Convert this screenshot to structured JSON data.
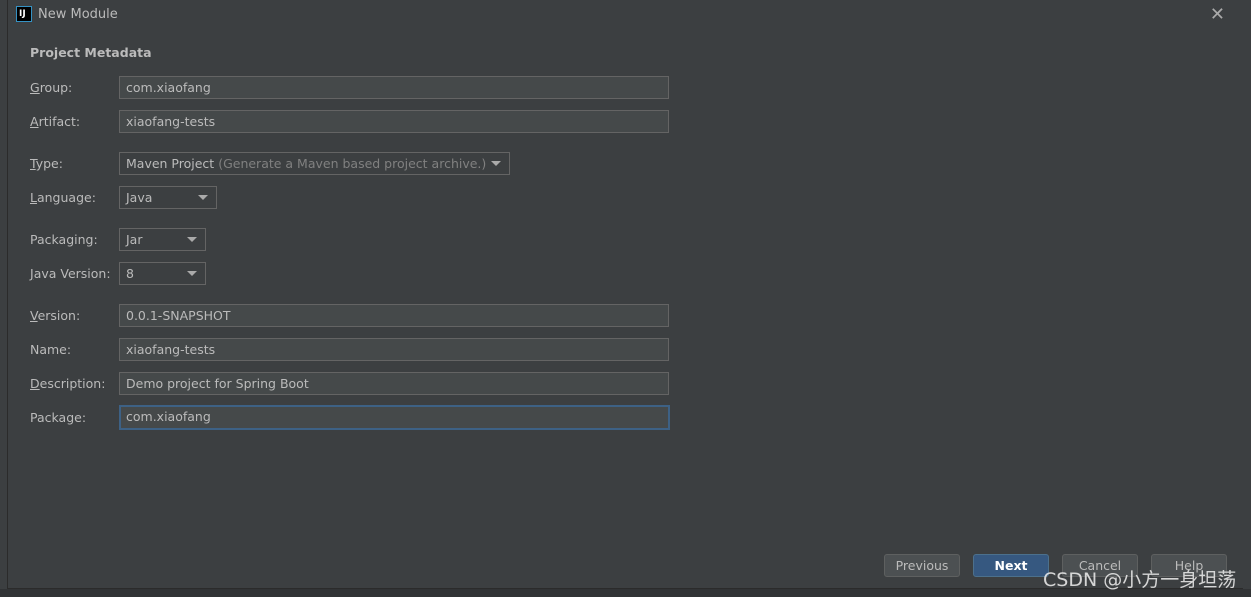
{
  "window": {
    "title": "New Module",
    "app_icon": "IJ"
  },
  "section_title": "Project Metadata",
  "fields": {
    "group": {
      "label": "Group:",
      "mn": "G",
      "rest": "roup:",
      "value": "com.xiaofang"
    },
    "artifact": {
      "label": "Artifact:",
      "mn": "A",
      "rest": "rtifact:",
      "value": "xiaofang-tests"
    },
    "type": {
      "label": "Type:",
      "mn": "T",
      "rest": "ype:",
      "value": "Maven Project",
      "hint": "(Generate a Maven based project archive.)"
    },
    "language": {
      "label": "Language:",
      "mn": "L",
      "rest": "anguage:",
      "value": "Java"
    },
    "packaging": {
      "label": "Packaging:",
      "value": "Jar"
    },
    "java_version": {
      "label": "Java Version:",
      "mn": "J",
      "rest": "ava Version:",
      "value": "8"
    },
    "version": {
      "label": "Version:",
      "mn": "V",
      "rest": "ersion:",
      "value": "0.0.1-SNAPSHOT"
    },
    "name": {
      "label": "Name:",
      "value": "xiaofang-tests"
    },
    "description": {
      "label": "Description:",
      "mn": "D",
      "rest": "escription:",
      "value": "Demo project for Spring Boot"
    },
    "package": {
      "label": "Package:",
      "value": "com.xiaofang"
    }
  },
  "buttons": {
    "previous": "Previous",
    "next": "Next",
    "cancel": "Cancel",
    "help": "Help"
  },
  "watermark": "CSDN @小方一身坦荡",
  "colors": {
    "background": "#3c3f41",
    "primary_button": "#365880",
    "focus_border": "#3d6185"
  }
}
